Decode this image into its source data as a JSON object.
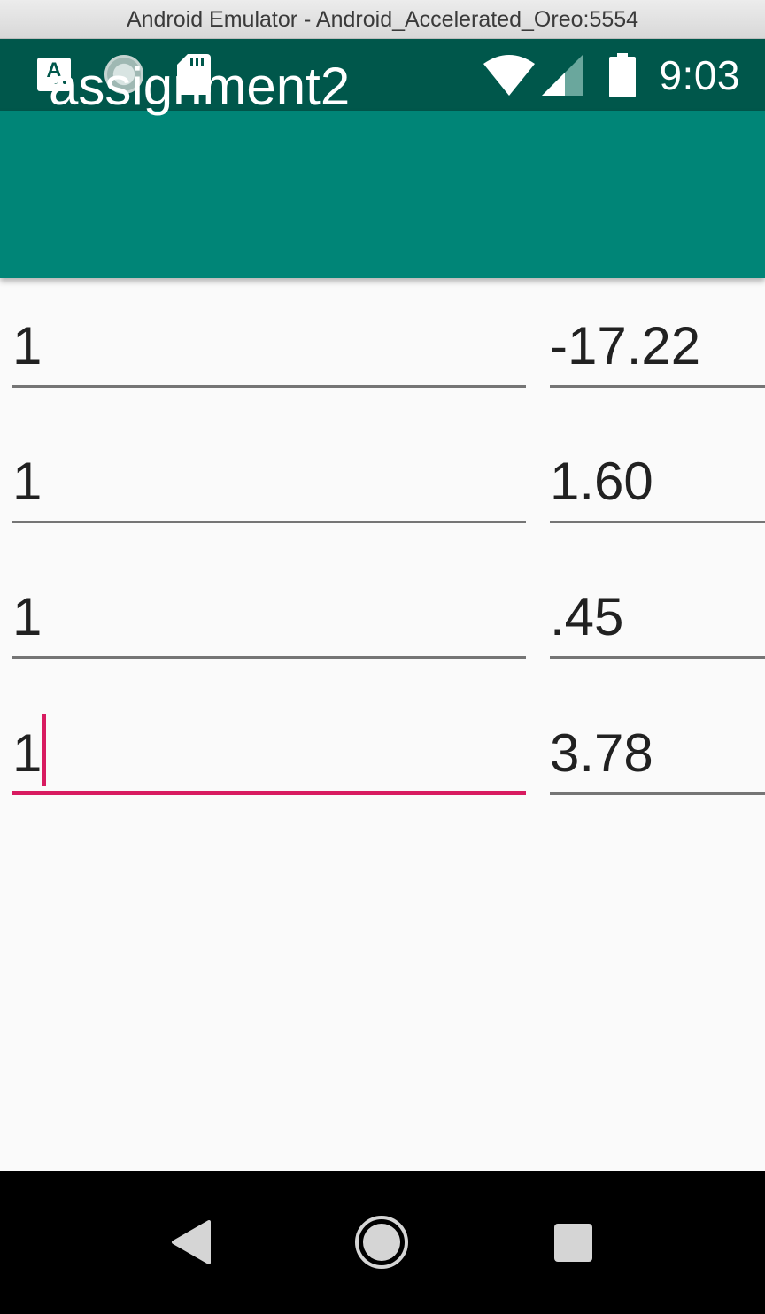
{
  "window": {
    "title": "Android Emulator - Android_Accelerated_Oreo:5554"
  },
  "status_bar": {
    "time": "9:03",
    "notification_icons": [
      "app-notification-icon",
      "sync-spinner-icon",
      "sd-card-icon"
    ],
    "system_icons": [
      "wifi-icon",
      "cell-signal-icon",
      "battery-icon"
    ],
    "background_color": "#00574b"
  },
  "app_bar": {
    "title": "assignment2",
    "color": "#008577"
  },
  "form": {
    "rows": [
      {
        "left": "1",
        "right": "-17.22"
      },
      {
        "left": "1",
        "right": "1.60"
      },
      {
        "left": "1",
        "right": ".45"
      },
      {
        "left": "1",
        "right": "3.78"
      }
    ],
    "focused_row": 3,
    "accent_color": "#d81b60"
  },
  "nav_bar": {
    "buttons": [
      "back-icon",
      "home-icon",
      "recents-icon"
    ]
  }
}
